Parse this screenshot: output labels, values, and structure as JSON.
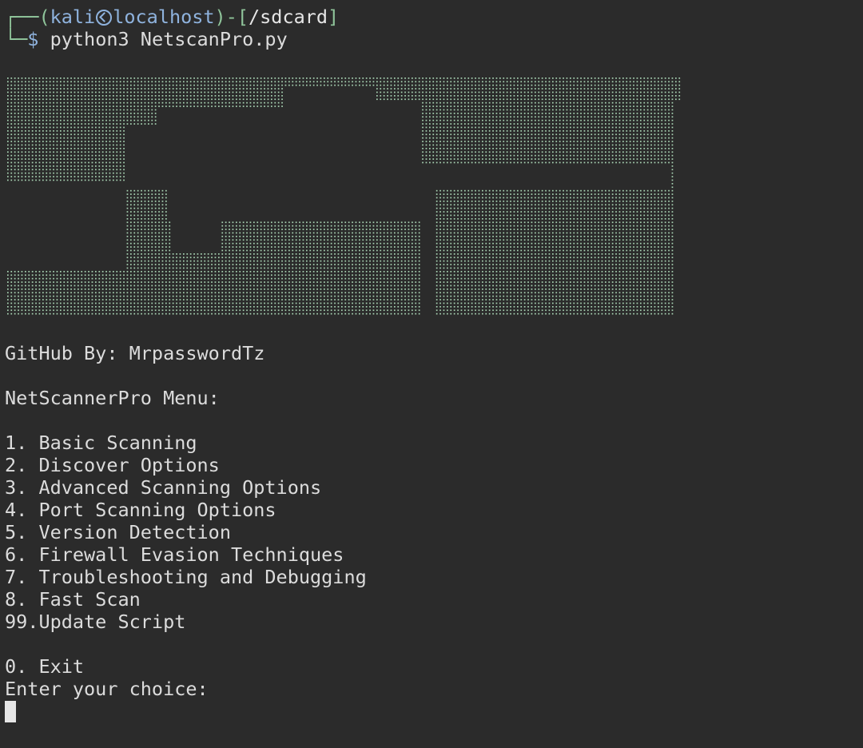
{
  "prompt": {
    "corner_top": "┌──",
    "open_paren": "(",
    "user": "kali",
    "host": "localhost",
    "close_paren": ")-[",
    "path": "/sdcard",
    "close_bracket": "]",
    "corner_bottom": "└─",
    "dollar": "$",
    "command": "python3 NetscanPro.py"
  },
  "banner": {
    "ascii_art_color": "#a9d4b4"
  },
  "output": {
    "github_credit": "GitHub By: MrpasswordTz",
    "menu_title": "NetScannerPro Menu:",
    "menu_items": [
      "1. Basic Scanning",
      "2. Discover Options",
      "3. Advanced Scanning Options",
      "4. Port Scanning Options",
      "5. Version Detection",
      "6. Firewall Evasion Techniques",
      "7. Troubleshooting and Debugging",
      "8. Fast Scan",
      "99.Update Script"
    ],
    "exit_item": "0. Exit",
    "input_prompt": "Enter your choice:"
  },
  "colors": {
    "background": "#2b2b2b",
    "text": "#dcdcdc",
    "prompt_green": "#8fc49a",
    "prompt_blue": "#8fb3de"
  }
}
